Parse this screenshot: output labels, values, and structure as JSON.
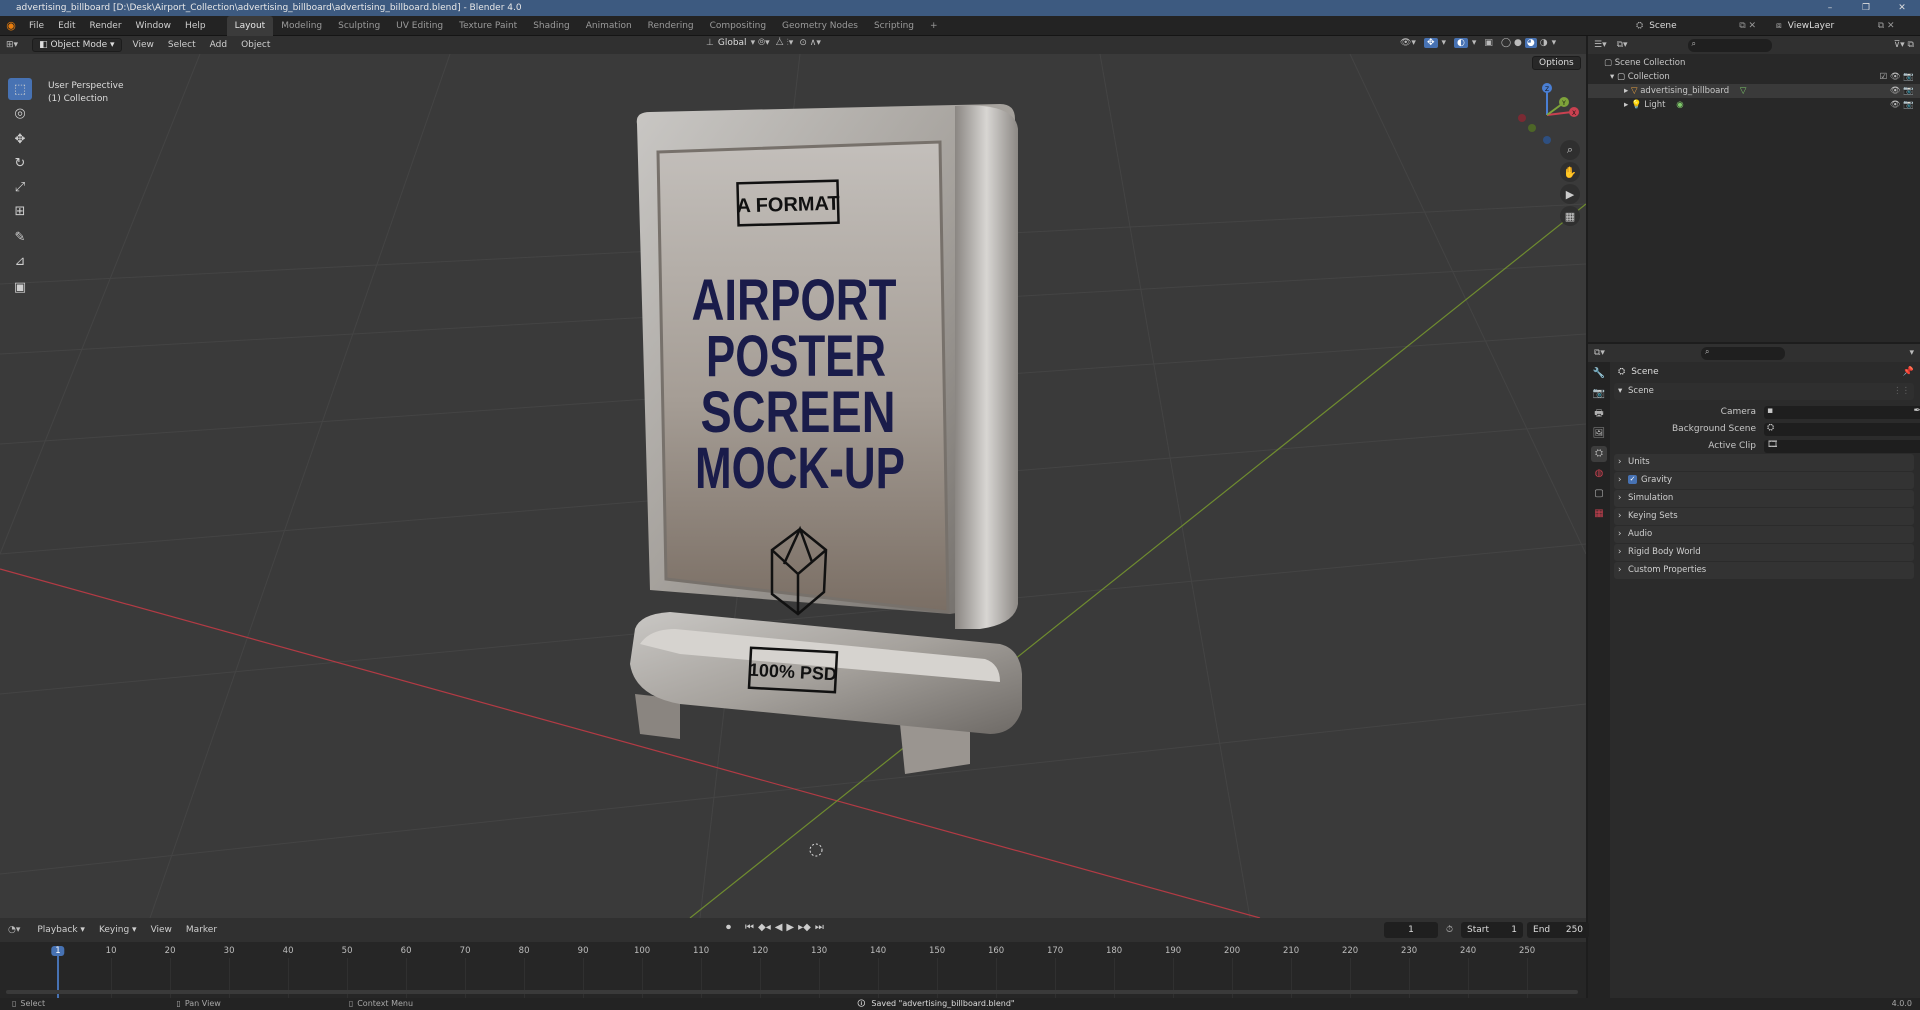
{
  "window": {
    "title": "advertising_billboard [D:\\Desk\\Airport_Collection\\advertising_billboard\\advertising_billboard.blend] - Blender 4.0",
    "controls": [
      "–",
      "❐",
      "✕"
    ]
  },
  "menubar": {
    "menus": [
      "File",
      "Edit",
      "Render",
      "Window",
      "Help"
    ],
    "workspaces": [
      "Layout",
      "Modeling",
      "Sculpting",
      "UV Editing",
      "Texture Paint",
      "Shading",
      "Animation",
      "Rendering",
      "Compositing",
      "Geometry Nodes",
      "Scripting",
      "+"
    ],
    "active_workspace": "Layout",
    "scene_label": "Scene",
    "viewlayer_label": "ViewLayer"
  },
  "viewport_header": {
    "mode": "Object Mode",
    "menus": [
      "View",
      "Select",
      "Add",
      "Object"
    ],
    "transform_orientation": "Global",
    "options_label": "Options"
  },
  "viewport": {
    "perspective_label": "User Perspective",
    "collection_label": "(1) Collection",
    "gizmo_axes": [
      "X",
      "Y",
      "Z"
    ],
    "background": "#3a3a3a",
    "x_axis_color": "#c0404a",
    "y_axis_color": "#7a9a3a"
  },
  "toolbar": {
    "tools": [
      {
        "name": "select-box",
        "glyph": "⬚",
        "active": true
      },
      {
        "name": "cursor",
        "glyph": "◎",
        "active": false
      },
      {
        "name": "move",
        "glyph": "✥",
        "active": false
      },
      {
        "name": "rotate",
        "glyph": "↻",
        "active": false
      },
      {
        "name": "scale",
        "glyph": "⤢",
        "active": false
      },
      {
        "name": "transform",
        "glyph": "⊞",
        "active": false
      },
      {
        "name": "annotate",
        "glyph": "✎",
        "active": false
      },
      {
        "name": "measure",
        "glyph": "📐",
        "active": false
      },
      {
        "name": "add-cube",
        "glyph": "▣",
        "active": false
      }
    ]
  },
  "billboard": {
    "badge_top": "A FORMAT",
    "headline": [
      "AIRPORT",
      "POSTER",
      "SCREEN",
      "MOCK-UP"
    ],
    "badge_bottom": "100% PSD",
    "headline_color": "#1a1c4a"
  },
  "outliner": {
    "root": "Scene Collection",
    "collection": "Collection",
    "objects": [
      {
        "name": "advertising_billboard",
        "icon_color": "#e8a040",
        "selected": true
      },
      {
        "name": "Light",
        "icon_color": "#e8a040",
        "selected": false
      }
    ]
  },
  "properties": {
    "header": "Scene",
    "section": "Scene",
    "fields": [
      {
        "label": "Camera"
      },
      {
        "label": "Background Scene"
      },
      {
        "label": "Active Clip"
      }
    ],
    "panels": [
      "Units",
      "Gravity",
      "Simulation",
      "Keying Sets",
      "Audio",
      "Rigid Body World",
      "Custom Properties"
    ],
    "gravity_checked": true
  },
  "timeline": {
    "menus": [
      "Playback",
      "Keying",
      "View",
      "Marker"
    ],
    "current_frame": "1",
    "start_label": "Start",
    "start": "1",
    "end_label": "End",
    "end": "250",
    "ticks": [
      "1",
      "10",
      "20",
      "30",
      "40",
      "50",
      "60",
      "70",
      "80",
      "90",
      "100",
      "110",
      "120",
      "130",
      "140",
      "150",
      "160",
      "170",
      "180",
      "190",
      "200",
      "210",
      "220",
      "230",
      "240",
      "250"
    ]
  },
  "statusbar": {
    "select": "Select",
    "pan": "Pan View",
    "context": "Context Menu",
    "message": "Saved \"advertising_billboard.blend\"",
    "version": "4.0.0"
  }
}
